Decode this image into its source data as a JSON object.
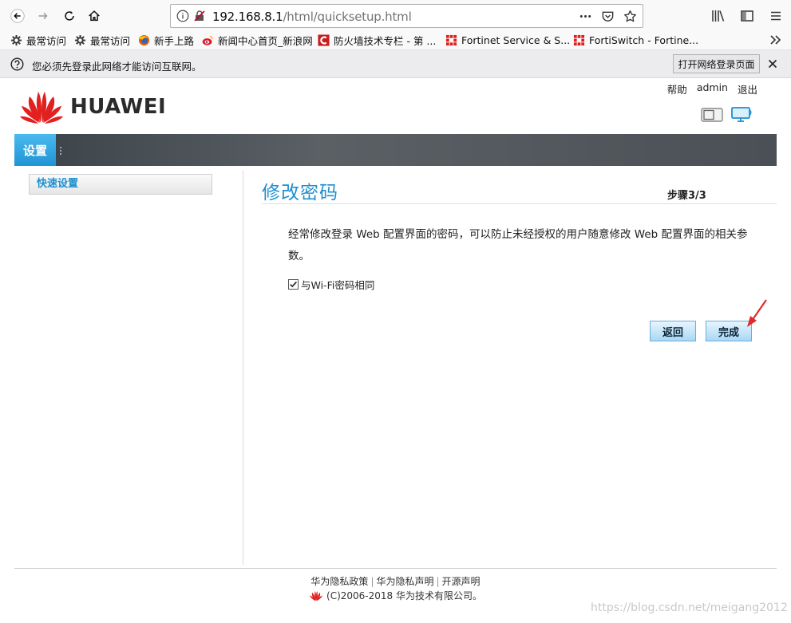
{
  "browser": {
    "url_host": "192.168.8.1",
    "url_path": "/html/quicksetup.html",
    "bookmarks": [
      {
        "label": "最常访问",
        "icon": "gear-icon"
      },
      {
        "label": "最常访问",
        "icon": "gear-icon"
      },
      {
        "label": "新手上路",
        "icon": "firefox-icon"
      },
      {
        "label": "新闻中心首页_新浪网",
        "icon": "sina-icon"
      },
      {
        "label": "防火墙技术专栏 - 第 ...",
        "icon": "csdn-icon"
      },
      {
        "label": "Fortinet Service & S...",
        "icon": "fortinet-icon"
      },
      {
        "label": "FortiSwitch - Fortine...",
        "icon": "fortinet-icon"
      }
    ],
    "notice": {
      "message": "您必须先登录此网络才能访问互联网。",
      "button": "打开网络登录页面"
    }
  },
  "page": {
    "top_links": [
      "帮助",
      "admin",
      "退出"
    ],
    "brand": "HUAWEI",
    "menu_tab": "设置",
    "sidebar_item": "快速设置",
    "title": "修改密码",
    "step": "步骤3/3",
    "description": "经常修改登录 Web 配置界面的密码，可以防止未经授权的用户随意修改 Web 配置界面的相关参数。",
    "checkbox_label": "与Wi-Fi密码相同",
    "checkbox_checked": true,
    "back_button": "返回",
    "done_button": "完成",
    "footer_links": [
      "华为隐私政策",
      "华为隐私声明",
      "开源声明"
    ],
    "copyright": "(C)2006-2018 华为技术有限公司。",
    "watermark": "https://blog.csdn.net/meigang2012"
  },
  "colors": {
    "accent_blue": "#1d8fd0",
    "huawei_red": "#e1201f",
    "annotation_arrow": "#e02b2b"
  }
}
